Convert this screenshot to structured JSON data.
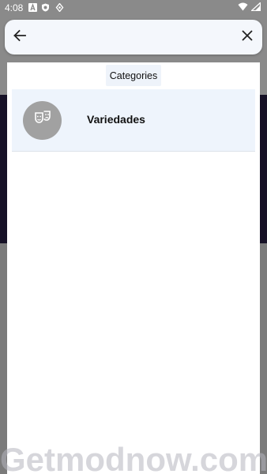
{
  "status_bar": {
    "time": "4:08",
    "left_icons": [
      "font-icon",
      "shield-icon",
      "location-icon"
    ],
    "right_icons": [
      "wifi-icon",
      "signal-icon"
    ]
  },
  "search": {
    "value": "",
    "placeholder": ""
  },
  "categories_label": "Categories",
  "results": [
    {
      "label": "Variedades",
      "icon": "theater-masks-icon"
    }
  ],
  "watermark": "Getmodnow.com",
  "colors": {
    "search_bar_bg": "#f4f7fc",
    "row_bg": "#eef4fc",
    "avatar_bg": "#a1a1a1",
    "background_dim": "#7c7c7c"
  }
}
